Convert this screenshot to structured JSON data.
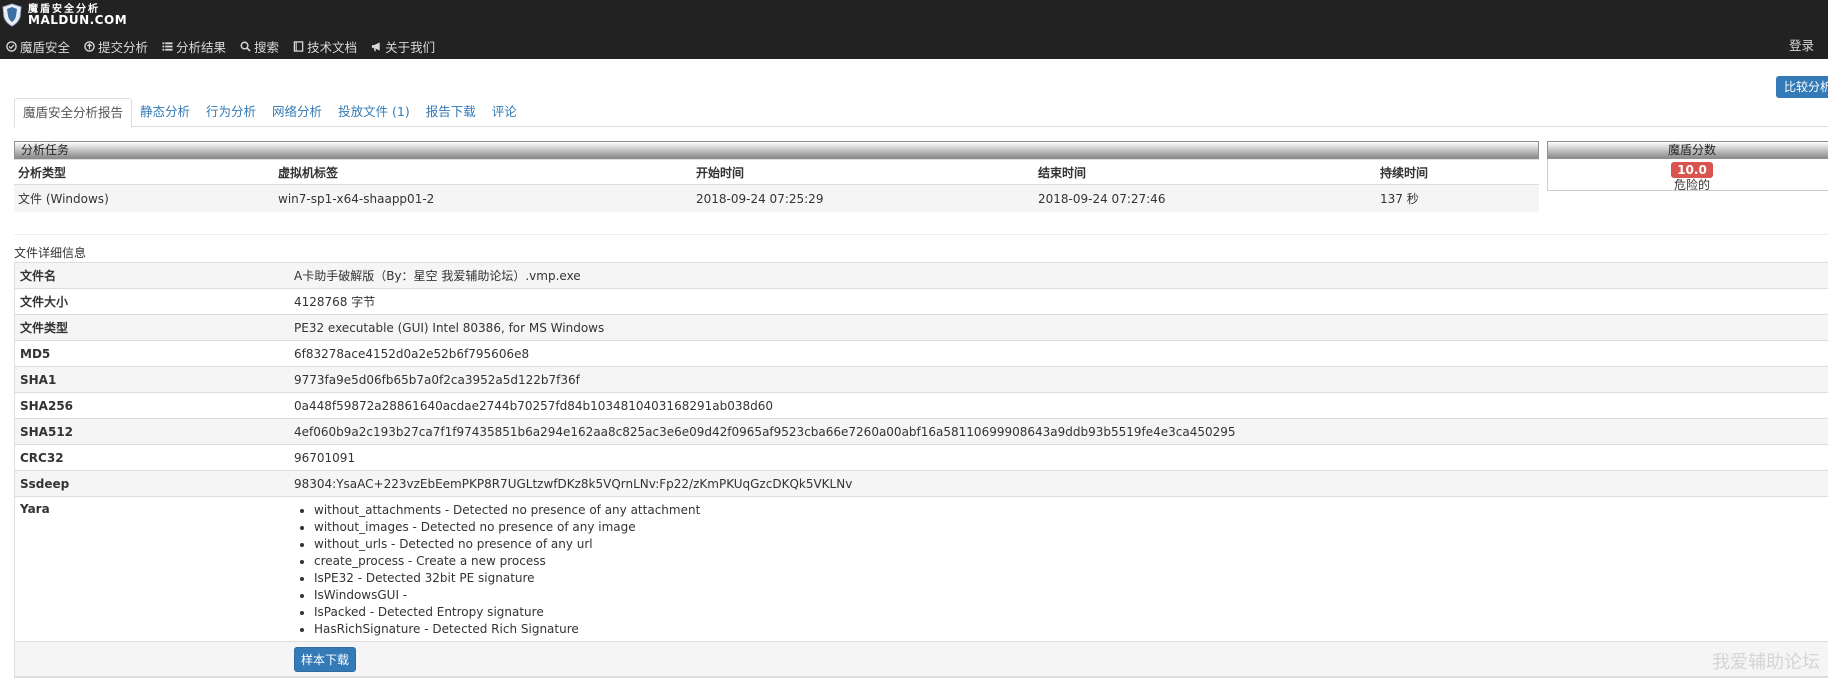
{
  "brand": {
    "name_cn": "魔盾安全分析",
    "name_en": "MALDUN.COM"
  },
  "nav": [
    {
      "label": "魔盾安全",
      "icon": "circle-check-icon"
    },
    {
      "label": "提交分析",
      "icon": "upload-circle-icon"
    },
    {
      "label": "分析结果",
      "icon": "list-icon"
    },
    {
      "label": "搜索",
      "icon": "search-icon"
    },
    {
      "label": "技术文档",
      "icon": "book-icon"
    },
    {
      "label": "关于我们",
      "icon": "bullhorn-icon"
    }
  ],
  "login_label": "登录",
  "compare_button": "比较分析",
  "tabs": [
    {
      "label": "魔盾安全分析报告",
      "active": true
    },
    {
      "label": "静态分析"
    },
    {
      "label": "行为分析"
    },
    {
      "label": "网络分析"
    },
    {
      "label": "投放文件 (1)"
    },
    {
      "label": "报告下载"
    },
    {
      "label": "评论"
    }
  ],
  "task": {
    "title": "分析任务",
    "headers": [
      "分析类型",
      "虚拟机标签",
      "开始时间",
      "结束时间",
      "持续时间"
    ],
    "row": [
      "文件 (Windows)",
      "win7-sp1-x64-shaapp01-2",
      "2018-09-24 07:25:29",
      "2018-09-24 07:27:46",
      "137 秒"
    ]
  },
  "score": {
    "title": "魔盾分数",
    "value": "10.0",
    "level": "危险的",
    "color": "#d9534f"
  },
  "file_detail": {
    "title": "文件详细信息",
    "rows": [
      {
        "key": "文件名",
        "value": "A卡助手破解版（By：星空 我爱辅助论坛）.vmp.exe"
      },
      {
        "key": "文件大小",
        "value": "4128768 字节"
      },
      {
        "key": "文件类型",
        "value": "PE32 executable (GUI) Intel 80386, for MS Windows"
      },
      {
        "key": "MD5",
        "value": "6f83278ace4152d0a2e52b6f795606e8"
      },
      {
        "key": "SHA1",
        "value": "9773fa9e5d06fb65b7a0f2ca3952a5d122b7f36f"
      },
      {
        "key": "SHA256",
        "value": "0a448f59872a28861640acdae2744b70257fd84b1034810403168291ab038d60"
      },
      {
        "key": "SHA512",
        "value": "4ef060b9a2c193b27ca7f1f97435851b6a294e162aa8c825ac3e6e09d42f0965af9523cba66e7260a00abf16a58110699908643a9ddb93b5519fe4e3ca450295"
      },
      {
        "key": "CRC32",
        "value": "96701091"
      },
      {
        "key": "Ssdeep",
        "value": "98304:YsaAC+223vzEbEemPKP8R7UGLtzwfDKz8k5VQrnLNv:Fp22/zKmPKUqGzcDKQk5VKLNv"
      }
    ],
    "yara_key": "Yara",
    "yara": [
      "without_attachments - Detected no presence of any attachment",
      "without_images - Detected no presence of any image",
      "without_urls - Detected no presence of any url",
      "create_process - Create a new process",
      "IsPE32 - Detected 32bit PE signature",
      "IsWindowsGUI -",
      "IsPacked - Detected Entropy signature",
      "HasRichSignature - Detected Rich Signature"
    ],
    "download_label": "样本下载"
  },
  "watermark": "我爱辅助论坛"
}
